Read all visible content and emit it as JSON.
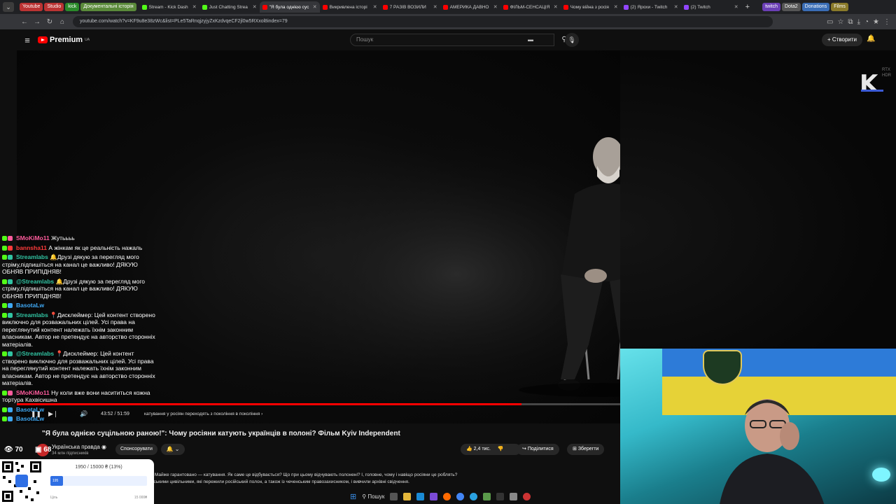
{
  "browser": {
    "chips": [
      {
        "label": "Youtube",
        "color": "#b33"
      },
      {
        "label": "Studio",
        "color": "#b33"
      },
      {
        "label": "kick",
        "color": "#2a8a2a"
      },
      {
        "label": "Документальні історія",
        "color": "#5a8a3a"
      }
    ],
    "tabs": [
      {
        "label": "Stream - Kick Dash",
        "color": "#53fc18"
      },
      {
        "label": "Just Chatting Strea",
        "color": "#53fc18"
      },
      {
        "label": "\"Я була однією сус",
        "color": "#ff0000",
        "active": true
      },
      {
        "label": "Викривлена історі",
        "color": "#ff0000"
      },
      {
        "label": "7 РАЗІВ ВОЗИЛИ",
        "color": "#ff0000"
      },
      {
        "label": "АМЕРИКА ДАВНО",
        "color": "#ff0000"
      },
      {
        "label": "ФІЛЬМ-СЕНСАЦІЯ",
        "color": "#ff0000"
      },
      {
        "label": "Чому війна з росія",
        "color": "#ff0000"
      },
      {
        "label": "(2) Ярохи - Twitch",
        "color": "#9146ff"
      },
      {
        "label": "(2) Twitch",
        "color": "#9146ff"
      }
    ],
    "right_chips": [
      {
        "label": "twitch",
        "color": "#6b3fb5"
      },
      {
        "label": "Dota2",
        "color": "#555"
      },
      {
        "label": "Donations",
        "color": "#3a6db5"
      },
      {
        "label": "Films",
        "color": "#8a7a2a"
      }
    ],
    "url": "youtube.com/watch?v=KF9u8e38zWc&list=PLe5TaRnqjzyjyZxKzdvqeCF2jl0w5RXxol8index=79"
  },
  "youtube": {
    "logo_text": "Premium",
    "logo_sup": "UA",
    "search_placeholder": "Пошук",
    "create_label": "Створити"
  },
  "video": {
    "watermark": "K",
    "rtx_line1": "RTX",
    "rtx_line2": "HDR",
    "progress": 0.836,
    "time": "43:52 / 51:59",
    "chapter": "катування у росіян переходять з покоління в покоління",
    "title": "\"Я була однією суцільною раною!\": Чому росіяни катують українців в полоні? Фільм Kyiv Independent",
    "channel": "Українська правда",
    "subs": "34 млн підписників",
    "sponsor_label": "Спонсорувати",
    "likes": "2,4 тис.",
    "share": "Поділитися",
    "save": "Зберегти",
    "description_line1": "полоні? Майже гарантовано — катування. Як саме це відбувається? Що при цьому відчувають полонені? І, головне, чому і навіщо росіяни це роблять?",
    "description_line2": "з українськими цивільними, які пережили російський полон, а також із чеченським правозахисником, і вивчили архівні свідчення."
  },
  "chat": {
    "messages": [
      {
        "user": "SMoKiMo11",
        "color": "#ff5c9d",
        "text": "Жутьььь"
      },
      {
        "user": "bannsha11",
        "color": "#ff3b3b",
        "text": "А жінкам як це реальність нажаль"
      },
      {
        "user": "Streamlabs",
        "color": "#31c3a2",
        "text": "🔔Друзі дякую за перегляд мого стріму,підпишіться на канал це важливо! ДЯКУЮ ОБНЯВ ПРИПІДНЯВ!"
      },
      {
        "user": "@Streamlabs",
        "color": "#31c3a2",
        "text": "🔔Друзі дякую за перегляд мого стріму,підпишіться на канал це важливо! ДЯКУЮ ОБНЯВ ПРИПІДНЯВ!"
      },
      {
        "user": "BasotaLw",
        "color": "#3fa9f5",
        "text": ""
      },
      {
        "user": "Streamlabs",
        "color": "#31c3a2",
        "text": "📍Дисклеймер: Цей контент створено виключно для розважальних цілей. Усі права на переглянутий контент належать їхнім законним власникам. Автор не претендує на авторство сторонніх матеріалів."
      },
      {
        "user": "@Streamlabs",
        "color": "#31c3a2",
        "text": "📍Дисклеймер: Цей контент створено виключно для розважальних цілей. Усі права на переглянутий контент належать їхнім законним власникам. Автор не претендує на авторство сторонніх матеріалів."
      },
      {
        "user": "SMoKiMo11",
        "color": "#ff5c9d",
        "text": "Ну коли вже вони насититься кожна тортура Кахвісишна"
      },
      {
        "user": "BasotaLw",
        "color": "#3fa9f5",
        "text": ""
      },
      {
        "user": "BasotaLw",
        "color": "#3fa9f5",
        "text": ""
      }
    ],
    "viewers_left": "70",
    "viewers_right": "68"
  },
  "donation": {
    "amount": "1950 / 15000 ₴ (13%)",
    "bar_label": "195",
    "progress": 0.13,
    "min": "Ціль",
    "max": "15 000₴"
  },
  "taskbar": {
    "search_label": "Пошук"
  }
}
